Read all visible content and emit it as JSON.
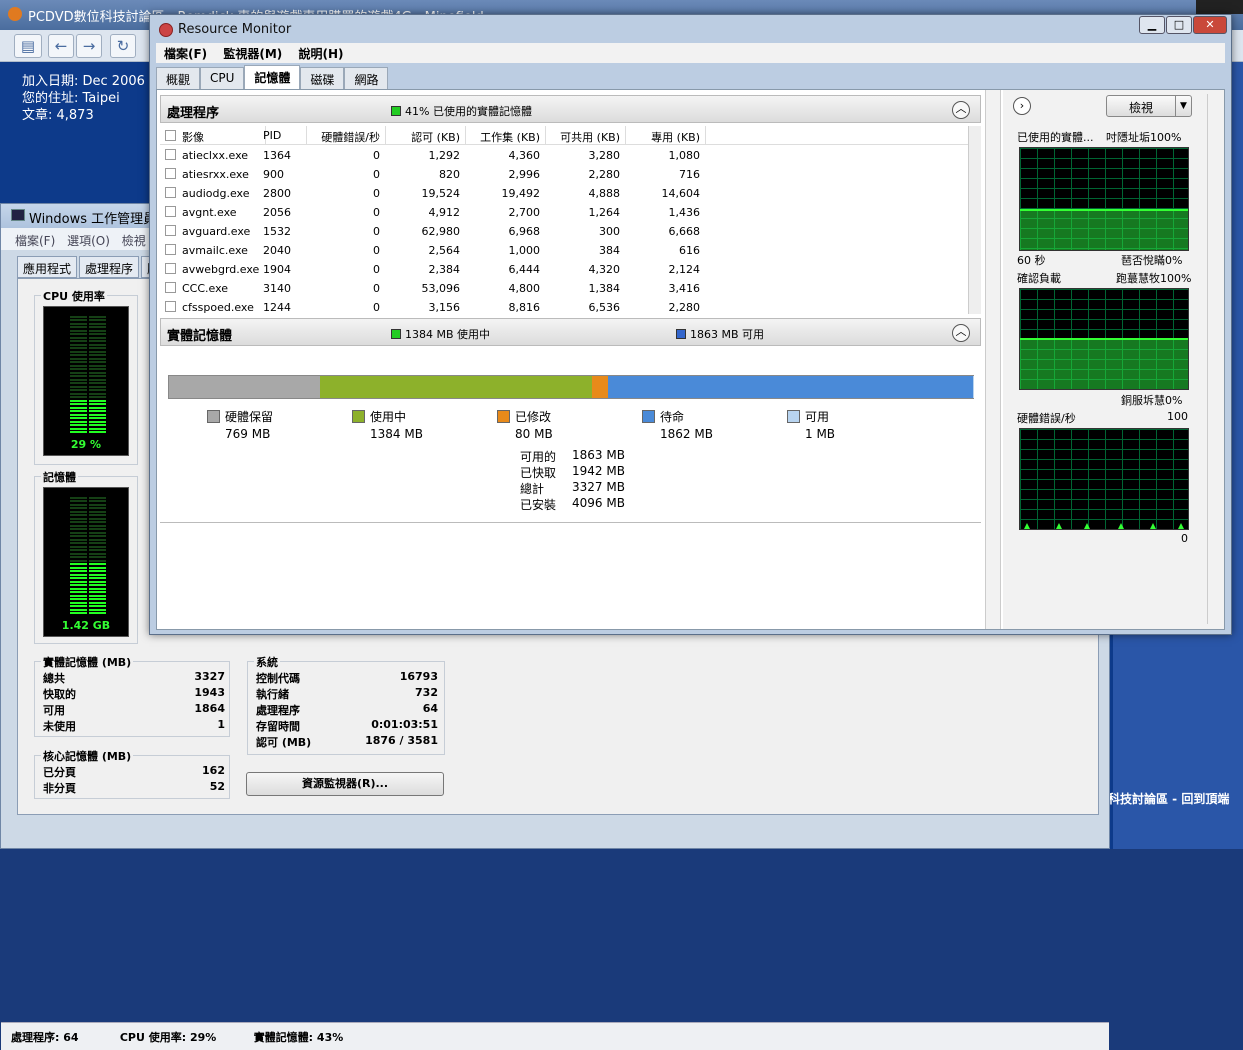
{
  "browser": {
    "title": "PCDVD數位科技討論區 - Remdick 專的與遊戲專用購買的遊戲4G - Minefield",
    "userinfo": [
      "加入日期: Dec 2006",
      "您的住址: Taipei",
      "文章: 4,873"
    ],
    "footer_link": "科技討論區 - 回到頂端"
  },
  "taskmgr": {
    "title": "Windows 工作管理員",
    "menu": "檔案(F) 選項(O) 檢視",
    "tabs": [
      "應用程式",
      "處理程序",
      "服"
    ],
    "cpu_group_title": "CPU 使用率",
    "cpu_value": "29 %",
    "cpu_percent": 29,
    "mem_group_title": "記憶體",
    "mem_value": "1.42 GB",
    "mem_percent": 43,
    "physical": {
      "title": "實體記憶體 (MB)",
      "rows": [
        [
          "總共",
          "3327"
        ],
        [
          "快取的",
          "1943"
        ],
        [
          "可用",
          "1864"
        ],
        [
          "未使用",
          "1"
        ]
      ]
    },
    "kernel": {
      "title": "核心記憶體 (MB)",
      "rows": [
        [
          "已分頁",
          "162"
        ],
        [
          "非分頁",
          "52"
        ]
      ]
    },
    "system": {
      "title": "系統",
      "rows": [
        [
          "控制代碼",
          "16793"
        ],
        [
          "執行緒",
          "732"
        ],
        [
          "處理程序",
          "64"
        ],
        [
          "存留時間",
          "0:01:03:51"
        ],
        [
          "認可 (MB)",
          "1876 / 3581"
        ]
      ]
    },
    "resmon_button": "資源監視器(R)...",
    "status": [
      "處理程序: 64",
      "CPU 使用率: 29%",
      "實體記憶體: 43%"
    ]
  },
  "resmon": {
    "title": "Resource Monitor",
    "menu": [
      "檔案(F)",
      "監視器(M)",
      "說明(H)"
    ],
    "tabs": [
      "概觀",
      "CPU",
      "記憶體",
      "磁碟",
      "網路"
    ],
    "active_tab": 2,
    "processes": {
      "title": "處理程序",
      "info": "41% 已使用的實體記憶體",
      "columns": [
        "影像",
        "PID",
        "硬體錯誤/秒",
        "認可 (KB)",
        "工作集 (KB)",
        "可共用 (KB)",
        "專用 (KB)"
      ],
      "rows": [
        [
          "atieclxx.exe",
          "1364",
          "0",
          "1,292",
          "4,360",
          "3,280",
          "1,080"
        ],
        [
          "atiesrxx.exe",
          "900",
          "0",
          "820",
          "2,996",
          "2,280",
          "716"
        ],
        [
          "audiodg.exe",
          "2800",
          "0",
          "19,524",
          "19,492",
          "4,888",
          "14,604"
        ],
        [
          "avgnt.exe",
          "2056",
          "0",
          "4,912",
          "2,700",
          "1,264",
          "1,436"
        ],
        [
          "avguard.exe",
          "1532",
          "0",
          "62,980",
          "6,968",
          "300",
          "6,668"
        ],
        [
          "avmailc.exe",
          "2040",
          "0",
          "2,564",
          "1,000",
          "384",
          "616"
        ],
        [
          "avwebgrd.exe",
          "1904",
          "0",
          "2,384",
          "6,444",
          "4,320",
          "2,124"
        ],
        [
          "CCC.exe",
          "3140",
          "0",
          "53,096",
          "4,800",
          "1,384",
          "3,416"
        ],
        [
          "cfsspoed.exe",
          "1244",
          "0",
          "3,156",
          "8,816",
          "6,536",
          "2,280"
        ]
      ]
    },
    "memory": {
      "title": "實體記憶體",
      "in_use_info": "1384 MB 使用中",
      "available_info": "1863 MB 可用",
      "legend": [
        {
          "label": "硬體保留",
          "value": "769 MB",
          "color": "#a8a8a8"
        },
        {
          "label": "使用中",
          "value": "1384 MB",
          "color": "#8db12b"
        },
        {
          "label": "已修改",
          "value": "80 MB",
          "color": "#e88a1a"
        },
        {
          "label": "待命",
          "value": "1862 MB",
          "color": "#4a8ad8"
        },
        {
          "label": "可用",
          "value": "1 MB",
          "color": "#b8d4f0"
        }
      ],
      "stats": [
        [
          "可用的",
          "1863 MB"
        ],
        [
          "已快取",
          "1942 MB"
        ],
        [
          "總計",
          "3327 MB"
        ],
        [
          "已安裝",
          "4096 MB"
        ]
      ]
    },
    "right": {
      "view_button": "檢視",
      "g1_title": "已使用的實體...",
      "g1_right": "吋隱址垢100%",
      "g1_bottom_left": "60 秒",
      "g1_bottom_right": "琶否悅瞞0%",
      "g2_title": "確認負載",
      "g2_right": "跑蕞慧牧100%",
      "g2_bottom_right": "銅服坼慧0%",
      "g3_title": "硬體錯誤/秒",
      "g3_right": "100",
      "g3_bottom_right": "0"
    }
  }
}
